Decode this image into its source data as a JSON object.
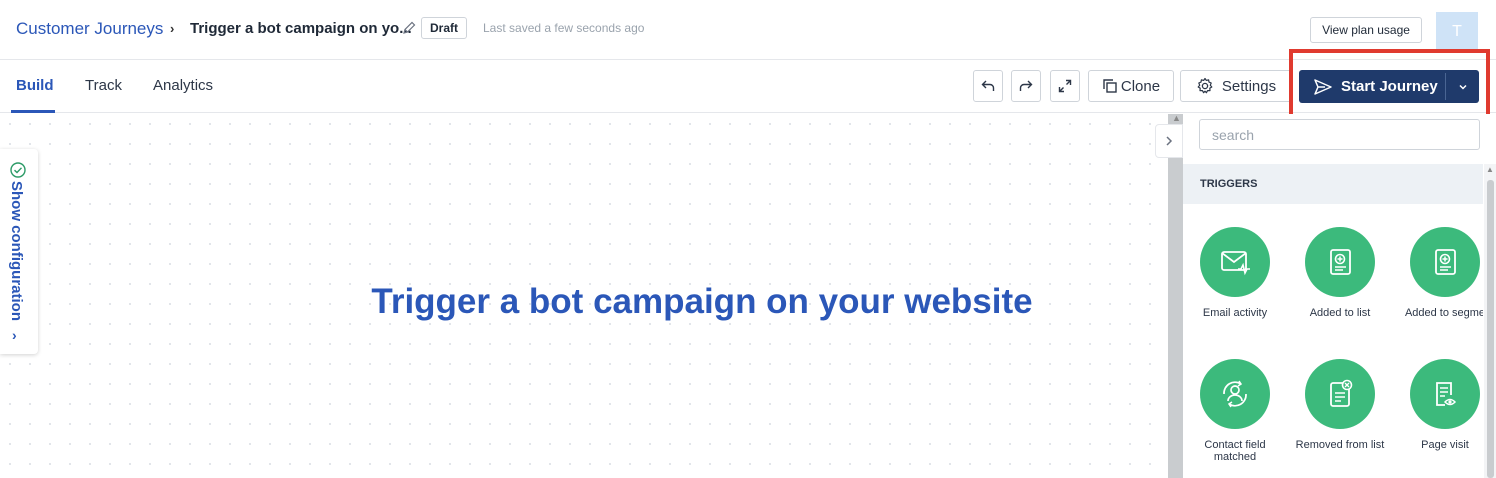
{
  "header": {
    "breadcrumb_root": "Customer Journeys",
    "breadcrumb_sep": "›",
    "journey_title": "Trigger a bot campaign on yo...",
    "status_badge": "Draft",
    "saved_status": "Last saved a few seconds ago",
    "plan_button": "View plan usage",
    "avatar_initial": "T"
  },
  "tabs": [
    {
      "label": "Build",
      "active": true
    },
    {
      "label": "Track",
      "active": false
    },
    {
      "label": "Analytics",
      "active": false
    }
  ],
  "toolbar": {
    "undo_icon": "undo-icon",
    "redo_icon": "redo-icon",
    "fullscreen_icon": "expand-icon",
    "clone_label": "Clone",
    "settings_label": "Settings",
    "start_label": "Start Journey"
  },
  "canvas": {
    "title": "Trigger a bot campaign on your website",
    "config_label": "Show configuration",
    "config_arrow": "›"
  },
  "panel": {
    "search_placeholder": "search",
    "section_title": "TRIGGERS",
    "triggers": [
      {
        "label": "Email activity",
        "icon": "email-activity-icon"
      },
      {
        "label": "Added to list",
        "icon": "added-to-list-icon"
      },
      {
        "label": "Added to segme",
        "icon": "added-to-segment-icon"
      },
      {
        "label": "Contact field matched",
        "icon": "contact-field-icon"
      },
      {
        "label": "Removed from list",
        "icon": "removed-from-list-icon"
      },
      {
        "label": "Page visit",
        "icon": "page-visit-icon"
      }
    ]
  },
  "colors": {
    "brand_blue": "#2b57b8",
    "start_button": "#1f3a6b",
    "trigger_green": "#3cba7c",
    "highlight_red": "#e03a2f"
  }
}
